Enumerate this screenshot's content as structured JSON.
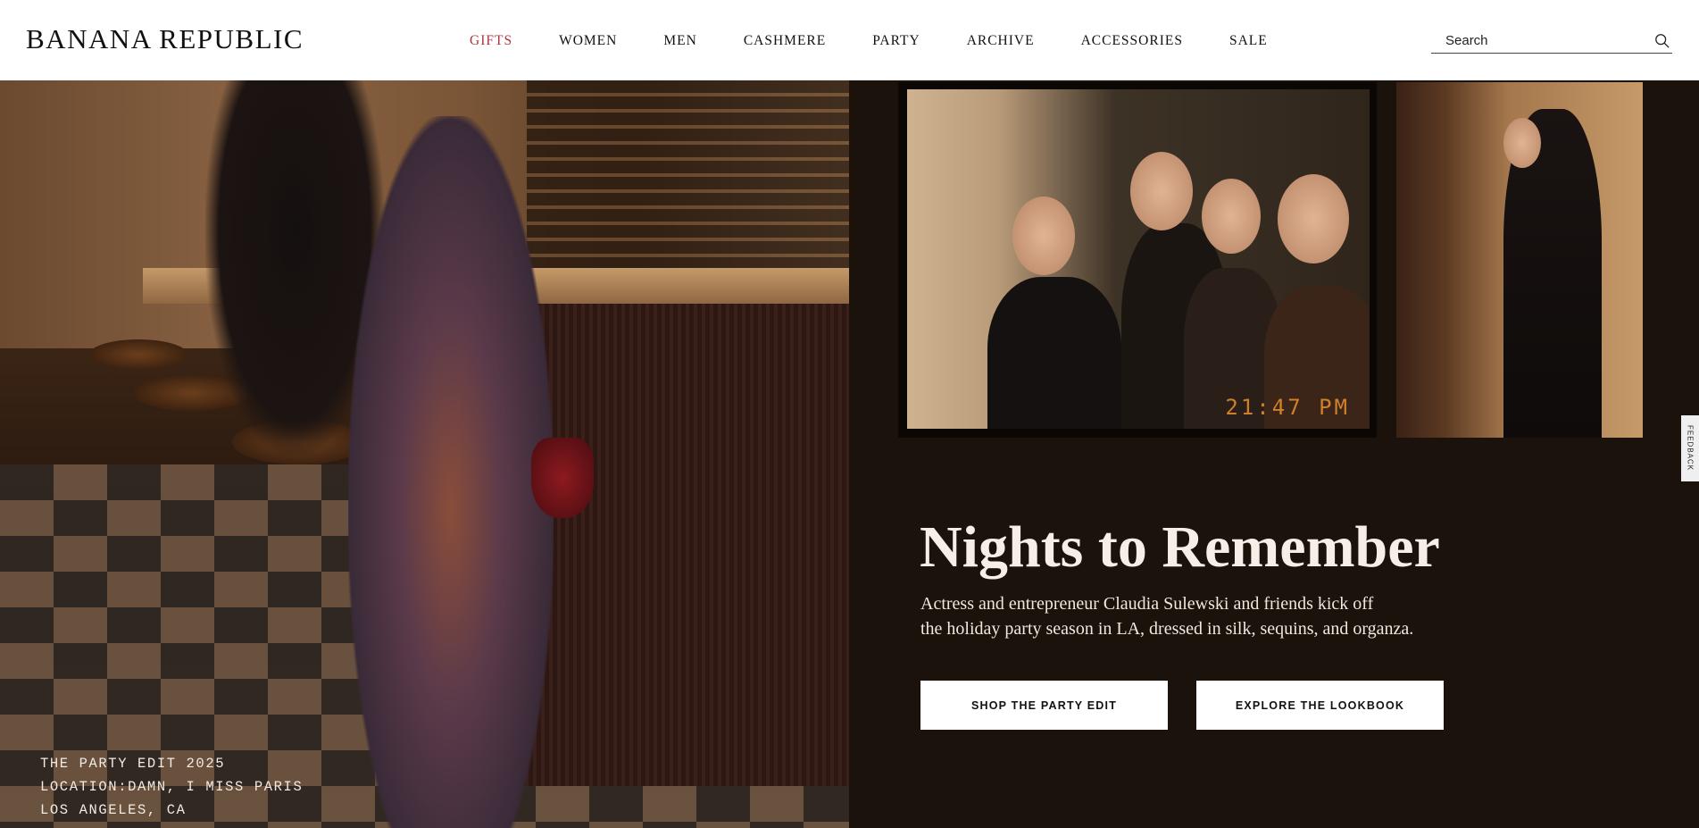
{
  "header": {
    "logo": "BANANA REPUBLIC",
    "nav": [
      {
        "label": "GIFTS",
        "active": true
      },
      {
        "label": "WOMEN"
      },
      {
        "label": "MEN"
      },
      {
        "label": "CASHMERE"
      },
      {
        "label": "PARTY"
      },
      {
        "label": "ARCHIVE"
      },
      {
        "label": "ACCESSORIES"
      },
      {
        "label": "SALE"
      }
    ],
    "search": {
      "placeholder": "Search",
      "icon": "search-icon"
    }
  },
  "hero": {
    "caption": [
      "THE PARTY EDIT 2025",
      "LOCATION:DAMN, I MISS PARIS",
      "LOS ANGELES, CA"
    ],
    "photo_timestamp": "21:47 PM",
    "headline": "Nights to Remember",
    "subtext_line1": "Actress and entrepreneur Claudia Sulewski and friends kick off",
    "subtext_line2": "the holiday party season in LA, dressed in silk, sequins, and organza.",
    "buttons": {
      "shop": "SHOP THE PARTY EDIT",
      "lookbook": "EXPLORE THE LOOKBOOK"
    }
  },
  "feedback_tab": "FEEDBACK",
  "colors": {
    "nav_active": "#b0343c",
    "panel_bg": "#1a120b",
    "button_bg": "#ffffff"
  }
}
